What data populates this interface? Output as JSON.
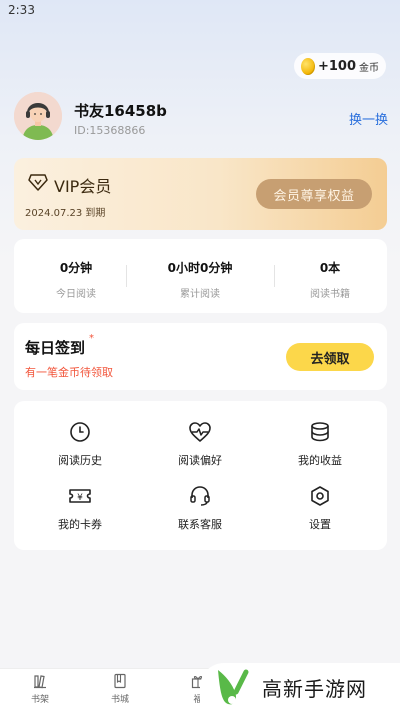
{
  "status_bar": {
    "time": "2:33"
  },
  "coins": {
    "amount": "+100",
    "unit": "金币"
  },
  "user": {
    "name": "书友16458b",
    "id": "ID:15368866",
    "switch_label": "换一换"
  },
  "vip": {
    "title": "VIP会员",
    "expiry": "2024.07.23 到期",
    "benefit_button": "会员尊享权益"
  },
  "stats": [
    {
      "value": "0分钟",
      "label": "今日阅读"
    },
    {
      "value": "0小时0分钟",
      "label": "累计阅读"
    },
    {
      "value": "0本",
      "label": "阅读书籍"
    }
  ],
  "sign_in": {
    "title": "每日签到",
    "badge": "*",
    "subtitle": "有一笔金币待领取",
    "button": "去领取"
  },
  "menu": [
    {
      "label": "阅读历史",
      "icon": "clock-icon"
    },
    {
      "label": "阅读偏好",
      "icon": "heart-pulse-icon"
    },
    {
      "label": "我的收益",
      "icon": "coins-stack-icon"
    },
    {
      "label": "我的卡券",
      "icon": "ticket-icon"
    },
    {
      "label": "联系客服",
      "icon": "headset-icon"
    },
    {
      "label": "设置",
      "icon": "settings-hexagon-icon"
    }
  ],
  "tabbar": [
    {
      "label": "书架",
      "icon": "bookshelf-icon"
    },
    {
      "label": "书城",
      "icon": "book-icon"
    },
    {
      "label": "福",
      "icon": "gift-icon"
    }
  ],
  "watermark": {
    "text": "高新手游网"
  },
  "colors": {
    "link": "#2a6fdc",
    "accent_red": "#f2553b",
    "sign_button": "#fcd74a",
    "vip_button": "#c79f72"
  }
}
